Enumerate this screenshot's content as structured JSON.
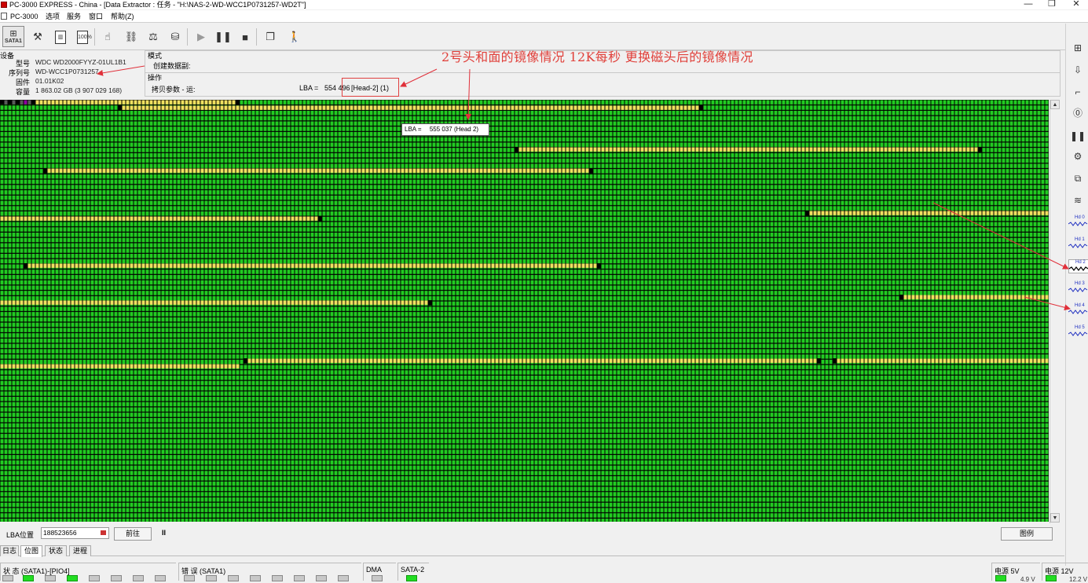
{
  "window": {
    "title": "PC-3000 EXPRESS - China - [Data Extractor : 任务 - \"H:\\NAS-2-WD-WCC1P0731257-WD2T\"]",
    "minimize_glyph": "—",
    "maximize_glyph": "❐",
    "close_glyph": "✕"
  },
  "menu": {
    "items": [
      "PC-3000",
      "选项",
      "服务",
      "窗口",
      "帮助(Z)"
    ]
  },
  "toolbar": {
    "sata_label": "SATA1",
    "icons": [
      "sata-icon",
      "tools-icon",
      "memory-icon",
      "log-icon",
      "percent-icon",
      "cursor-icon",
      "binoculars-icon",
      "scale-icon",
      "disk-icon",
      "play-icon",
      "pause-icon",
      "stop-icon",
      "windows-icon",
      "exit-icon"
    ],
    "log_box": "LOG",
    "percent_box": "100%"
  },
  "device": {
    "group_label": "设备",
    "model_key": "型号",
    "model": "WDC WD2000FYYZ-01UL1B1",
    "serial_key": "序列号",
    "serial": "WD-WCC1P0731257",
    "firmware_key": "固件",
    "firmware": "01.01K02",
    "capacity_key": "容量",
    "capacity": "1 863.02 GB (3 907 029 168)"
  },
  "mode": {
    "group_label": "模式",
    "value": "创建数据副:"
  },
  "operation": {
    "group_label": "操作",
    "value": "拷贝参数 - 运:",
    "lba_label": "LBA =",
    "lba_value": "554 496",
    "lba_head": "[Head-2] (1)"
  },
  "tooltip": {
    "label": "LBA =",
    "value": "555 037 (Head 2)"
  },
  "annotation": {
    "text": "2号头和面的镜像情况    12K每秒    更换磁头后的镜像情况",
    "color": "#e0403a"
  },
  "map": {
    "colors": {
      "good": "#22cc22",
      "read": "#f0e060",
      "bad": "#000000",
      "pending": "#9000a0"
    },
    "note_rows": "row index from top, each row ~4.4% of height",
    "segments": [
      {
        "row": 0,
        "from": 0.0,
        "to": 0.022,
        "state": "bad_pattern"
      },
      {
        "row": 0,
        "from": 0.022,
        "to": 0.026,
        "state": "pending"
      },
      {
        "row": 0,
        "from": 0.026,
        "to": 0.032,
        "state": "bad_pattern"
      },
      {
        "row": 0,
        "from": 0.032,
        "to": 0.226,
        "state": "read"
      },
      {
        "row": 1,
        "from": 0.113,
        "to": 0.668,
        "state": "read"
      },
      {
        "row": 9,
        "from": 0.489,
        "to": 0.932,
        "state": "read"
      },
      {
        "row": 13,
        "from": 0.043,
        "to": 0.56,
        "state": "read"
      },
      {
        "row": 21,
        "from": 0.769,
        "to": 1.0,
        "state": "read"
      },
      {
        "row": 22,
        "from": 0.0,
        "to": 0.302,
        "state": "read"
      },
      {
        "row": 31,
        "from": 0.021,
        "to": 0.569,
        "state": "read"
      },
      {
        "row": 37,
        "from": 0.857,
        "to": 1.0,
        "state": "read"
      },
      {
        "row": 38,
        "from": 0.0,
        "to": 0.41,
        "state": "read"
      },
      {
        "row": 49,
        "from": 0.231,
        "to": 0.779,
        "state": "read"
      },
      {
        "row": 49,
        "from": 0.795,
        "to": 1.0,
        "state": "read"
      },
      {
        "row": 50,
        "from": 0.0,
        "to": 0.068,
        "state": "read"
      },
      {
        "row": 50,
        "from": 0.068,
        "to": 0.23,
        "state": "read"
      }
    ],
    "bad_marks": [
      {
        "row": 0,
        "pos": 0.226
      },
      {
        "row": 1,
        "pos": 0.113
      },
      {
        "row": 1,
        "pos": 0.668
      },
      {
        "row": 9,
        "pos": 0.489
      },
      {
        "row": 9,
        "pos": 0.932
      },
      {
        "row": 13,
        "pos": 0.043
      },
      {
        "row": 13,
        "pos": 0.56
      },
      {
        "row": 21,
        "pos": 0.769
      },
      {
        "row": 22,
        "pos": 0.302
      },
      {
        "row": 31,
        "pos": 0.021
      },
      {
        "row": 31,
        "pos": 0.569
      },
      {
        "row": 37,
        "pos": 0.857
      },
      {
        "row": 38,
        "pos": 0.41
      },
      {
        "row": 49,
        "pos": 0.231
      },
      {
        "row": 49,
        "pos": 0.779
      },
      {
        "row": 49,
        "pos": 0.795
      }
    ]
  },
  "right_panel": {
    "heads": [
      "Hd 0",
      "Hd 1",
      "Hd 2",
      "Hd 3",
      "Hd 4",
      "Hd 5"
    ],
    "selected_head": "Hd 2"
  },
  "bottom": {
    "lba_label": "LBA位置",
    "lba_value": "188523656",
    "goto_button": "前往",
    "pause_glyph": "II",
    "chart_button": "图例"
  },
  "tabs": [
    "日志",
    "位图",
    "状态",
    "进程"
  ],
  "active_tab": "位图",
  "status": {
    "state_label": "状 态 (SATA1)-[PIO4]",
    "error_label": "错 误 (SATA1)",
    "dma_label": "DMA",
    "sata2_label": "SATA-2",
    "power5_label": "电源 5V",
    "power5_value": "4.9 V",
    "power12_label": "电源 12V",
    "power12_value": "12.2 V"
  }
}
